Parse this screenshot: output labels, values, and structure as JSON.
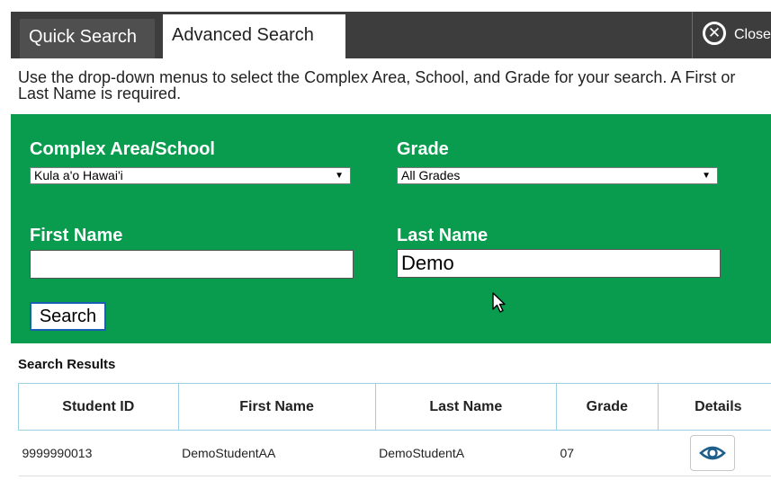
{
  "tabs": {
    "quick": "Quick Search",
    "advanced": "Advanced Search"
  },
  "close_label": "Close",
  "instructions": "Use the drop-down menus to select the Complex Area, School, and Grade for your search. A First or Last Name is required.",
  "form": {
    "complex_label": "Complex Area/School",
    "complex_value": "Kula a'o Hawai'i",
    "grade_label": "Grade",
    "grade_value": "All Grades",
    "first_name_label": "First Name",
    "first_name_value": "",
    "last_name_label": "Last Name",
    "last_name_value": "Demo",
    "search_button": "Search"
  },
  "results": {
    "title": "Search Results",
    "columns": [
      "Student ID",
      "First Name",
      "Last Name",
      "Grade",
      "Details"
    ],
    "rows": [
      {
        "student_id": "9999990013",
        "first_name": "DemoStudentAA",
        "last_name": "DemoStudentA",
        "grade": "07",
        "details_icon": "eye-icon"
      }
    ]
  },
  "colors": {
    "panel": "#0a9c4e",
    "tabbar": "#3d3d3d",
    "accent": "#1a5fb4"
  }
}
